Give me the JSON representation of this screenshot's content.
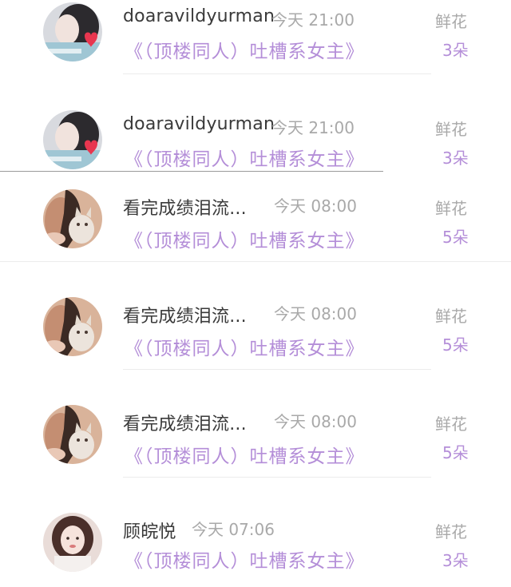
{
  "gift_list": {
    "items": [
      {
        "user_name": "doaravildyurman",
        "time": "今天 21:00",
        "work_title": "《（顶楼同人）吐槽系女主》",
        "gift_label": "鲜花",
        "gift_count": "3朵",
        "avatar": "avatar-girl-heart"
      },
      {
        "user_name": "doaravildyurman",
        "time": "今天 21:00",
        "work_title": "《（顶楼同人）吐槽系女主》",
        "gift_label": "鲜花",
        "gift_count": "3朵",
        "avatar": "avatar-girl-heart"
      },
      {
        "user_name": "看完成绩泪流...",
        "time": "今天 08:00",
        "work_title": "《（顶楼同人）吐槽系女主》",
        "gift_label": "鲜花",
        "gift_count": "5朵",
        "avatar": "avatar-girl-cat"
      },
      {
        "user_name": "看完成绩泪流...",
        "time": "今天 08:00",
        "work_title": "《（顶楼同人）吐槽系女主》",
        "gift_label": "鲜花",
        "gift_count": "5朵",
        "avatar": "avatar-girl-cat"
      },
      {
        "user_name": "看完成绩泪流...",
        "time": "今天 08:00",
        "work_title": "《（顶楼同人）吐槽系女主》",
        "gift_label": "鲜花",
        "gift_count": "5朵",
        "avatar": "avatar-girl-cat"
      },
      {
        "user_name": "顾皖悦",
        "time": "今天 07:06",
        "work_title": "《（顶楼同人）吐槽系女主》",
        "gift_label": "鲜花",
        "gift_count": "3朵",
        "avatar": "avatar-girl-portrait"
      }
    ]
  },
  "colors": {
    "accent_purple": "#b48ed8",
    "meta_gray": "#a9a9a9",
    "name_text": "#3a3a3a"
  }
}
